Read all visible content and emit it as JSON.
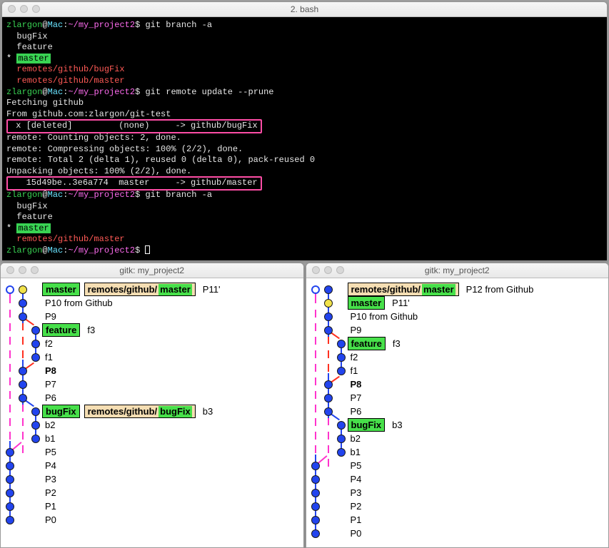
{
  "terminal": {
    "title": "2. bash",
    "prompt": {
      "user": "zlargon",
      "at": "@",
      "host": "Mac",
      "path": "~/my_project2",
      "sep": ":",
      "end": "$"
    },
    "lines": [
      {
        "t": "prompt",
        "cmd": "git branch -a"
      },
      {
        "t": "plain",
        "text": "  bugFix"
      },
      {
        "t": "plain",
        "text": "  feature"
      },
      {
        "t": "current",
        "text": "master"
      },
      {
        "t": "red",
        "text": "  remotes/github/bugFix"
      },
      {
        "t": "red",
        "text": "  remotes/github/master"
      },
      {
        "t": "prompt",
        "cmd": "git remote update --prune"
      },
      {
        "t": "plain",
        "text": "Fetching github"
      },
      {
        "t": "plain",
        "text": "From github.com:zlargon/git-test"
      },
      {
        "t": "boxed",
        "text": " x [deleted]         (none)     -> github/bugFix"
      },
      {
        "t": "plain",
        "text": "remote: Counting objects: 2, done."
      },
      {
        "t": "plain",
        "text": "remote: Compressing objects: 100% (2/2), done."
      },
      {
        "t": "plain",
        "text": "remote: Total 2 (delta 1), reused 0 (delta 0), pack-reused 0"
      },
      {
        "t": "plain",
        "text": "Unpacking objects: 100% (2/2), done."
      },
      {
        "t": "boxed",
        "text": "   15d49be..3e6a774  master     -> github/master"
      },
      {
        "t": "prompt",
        "cmd": "git branch -a"
      },
      {
        "t": "plain",
        "text": "  bugFix"
      },
      {
        "t": "plain",
        "text": "  feature"
      },
      {
        "t": "current",
        "text": "master"
      },
      {
        "t": "red",
        "text": "  remotes/github/master"
      },
      {
        "t": "prompt",
        "cmd": "",
        "cursor": true
      }
    ]
  },
  "gitk_left": {
    "title": "gitk: my_project2",
    "rows": [
      {
        "l0": "hollow",
        "l1": "node-head",
        "tags": [
          {
            "k": "local",
            "t": "master"
          },
          {
            "k": "remote",
            "p": "remotes/github/",
            "n": "master"
          }
        ],
        "msg": "P11'",
        "conn": {
          "l0": [
            "down",
            "pink"
          ],
          "l1": [
            "down",
            "blue"
          ]
        }
      },
      {
        "l0": "none",
        "l1": "node",
        "msg": "P10 from Github",
        "conn": {
          "l0": [
            "updown",
            "pink"
          ],
          "l1": [
            "updown",
            "blue"
          ]
        }
      },
      {
        "l0": "none",
        "l1": "node",
        "msg": "P9",
        "conn": {
          "l0": [
            "updown",
            "pink"
          ],
          "l1": [
            "updown",
            "blue"
          ],
          "spawn": "red"
        }
      },
      {
        "l0": "none",
        "l1": "none",
        "l2": "node",
        "tags": [
          {
            "k": "local",
            "t": "feature"
          }
        ],
        "msg": "f3",
        "conn": {
          "l0": [
            "updown",
            "pink"
          ],
          "l1": [
            "updown",
            "red"
          ],
          "l2": [
            "down",
            "blue"
          ]
        }
      },
      {
        "l0": "none",
        "l1": "none",
        "l2": "node",
        "msg": "f2",
        "conn": {
          "l0": [
            "updown",
            "pink"
          ],
          "l1": [
            "updown",
            "red"
          ],
          "l2": [
            "updown",
            "blue"
          ]
        }
      },
      {
        "l0": "none",
        "l1": "none",
        "l2": "node",
        "msg": "f1",
        "conn": {
          "l0": [
            "updown",
            "pink"
          ],
          "l1": [
            "updown",
            "red"
          ],
          "l2": [
            "up",
            "blue"
          ]
        }
      },
      {
        "l0": "none",
        "l1": "node",
        "msg": "P8",
        "bold": true,
        "conn": {
          "l0": [
            "updown",
            "pink"
          ],
          "l1": [
            "updown",
            "blue"
          ],
          "merge": "red"
        }
      },
      {
        "l0": "none",
        "l1": "node",
        "msg": "P7",
        "conn": {
          "l0": [
            "updown",
            "pink"
          ],
          "l1": [
            "updown",
            "blue"
          ]
        }
      },
      {
        "l0": "none",
        "l1": "node",
        "msg": "P6",
        "conn": {
          "l0": [
            "updown",
            "pink"
          ],
          "l1": [
            "updown",
            "blue"
          ],
          "spawn": "blue"
        }
      },
      {
        "l0": "none",
        "l1": "none",
        "l2": "node",
        "tags": [
          {
            "k": "local",
            "t": "bugFix"
          },
          {
            "k": "remote",
            "p": "remotes/github/",
            "n": "bugFix"
          }
        ],
        "msg": "b3",
        "conn": {
          "l0": [
            "updown",
            "pink"
          ],
          "l1": [
            "updown",
            "pink"
          ],
          "l2": [
            "down",
            "blue"
          ]
        }
      },
      {
        "l0": "none",
        "l1": "none",
        "l2": "node",
        "msg": "b2",
        "conn": {
          "l0": [
            "updown",
            "pink"
          ],
          "l1": [
            "updown",
            "pink"
          ],
          "l2": [
            "updown",
            "blue"
          ]
        }
      },
      {
        "l0": "none",
        "l1": "none",
        "l2": "node",
        "msg": "b1",
        "conn": {
          "l0": [
            "updown",
            "pink"
          ],
          "l1": [
            "updown",
            "pink"
          ],
          "l2": [
            "up",
            "blue"
          ]
        }
      },
      {
        "l0": "node",
        "msg": "P5",
        "conn": {
          "l0": [
            "updown",
            "blue"
          ],
          "mergeP": "pink"
        }
      },
      {
        "l0": "node",
        "msg": "P4",
        "conn": {
          "l0": [
            "updown",
            "blue"
          ]
        }
      },
      {
        "l0": "node",
        "msg": "P3",
        "conn": {
          "l0": [
            "updown",
            "blue"
          ]
        }
      },
      {
        "l0": "node",
        "msg": "P2",
        "conn": {
          "l0": [
            "updown",
            "blue"
          ]
        }
      },
      {
        "l0": "node",
        "msg": "P1",
        "conn": {
          "l0": [
            "updown",
            "blue"
          ]
        }
      },
      {
        "l0": "node",
        "msg": "P0",
        "conn": {
          "l0": [
            "up",
            "blue"
          ]
        }
      }
    ]
  },
  "gitk_right": {
    "title": "gitk: my_project2",
    "rows": [
      {
        "l0": "hollow",
        "l1": "node",
        "tags": [
          {
            "k": "remote",
            "p": "remotes/github/",
            "n": "master"
          }
        ],
        "msg": "P12 from Github",
        "conn": {
          "l0": [
            "down",
            "pink"
          ],
          "l1": [
            "down",
            "blue"
          ]
        }
      },
      {
        "l0": "none",
        "l1": "node-head",
        "tags": [
          {
            "k": "local",
            "t": "master"
          }
        ],
        "msg": "P11'",
        "conn": {
          "l0": [
            "updown",
            "pink"
          ],
          "l1": [
            "updown",
            "blue"
          ]
        }
      },
      {
        "l0": "none",
        "l1": "node",
        "msg": "P10 from Github",
        "conn": {
          "l0": [
            "updown",
            "pink"
          ],
          "l1": [
            "updown",
            "blue"
          ]
        }
      },
      {
        "l0": "none",
        "l1": "node",
        "msg": "P9",
        "conn": {
          "l0": [
            "updown",
            "pink"
          ],
          "l1": [
            "updown",
            "blue"
          ],
          "spawn": "red"
        }
      },
      {
        "l0": "none",
        "l1": "none",
        "l2": "node",
        "tags": [
          {
            "k": "local",
            "t": "feature"
          }
        ],
        "msg": "f3",
        "conn": {
          "l0": [
            "updown",
            "pink"
          ],
          "l1": [
            "updown",
            "red"
          ],
          "l2": [
            "down",
            "blue"
          ]
        }
      },
      {
        "l0": "none",
        "l1": "none",
        "l2": "node",
        "msg": "f2",
        "conn": {
          "l0": [
            "updown",
            "pink"
          ],
          "l1": [
            "updown",
            "red"
          ],
          "l2": [
            "updown",
            "blue"
          ]
        }
      },
      {
        "l0": "none",
        "l1": "none",
        "l2": "node",
        "msg": "f1",
        "conn": {
          "l0": [
            "updown",
            "pink"
          ],
          "l1": [
            "updown",
            "red"
          ],
          "l2": [
            "up",
            "blue"
          ]
        }
      },
      {
        "l0": "none",
        "l1": "node",
        "msg": "P8",
        "bold": true,
        "conn": {
          "l0": [
            "updown",
            "pink"
          ],
          "l1": [
            "updown",
            "blue"
          ],
          "merge": "red"
        }
      },
      {
        "l0": "none",
        "l1": "node",
        "msg": "P7",
        "conn": {
          "l0": [
            "updown",
            "pink"
          ],
          "l1": [
            "updown",
            "blue"
          ]
        }
      },
      {
        "l0": "none",
        "l1": "node",
        "msg": "P6",
        "conn": {
          "l0": [
            "updown",
            "pink"
          ],
          "l1": [
            "updown",
            "blue"
          ],
          "spawn": "blue"
        }
      },
      {
        "l0": "none",
        "l1": "none",
        "l2": "node",
        "tags": [
          {
            "k": "local",
            "t": "bugFix"
          }
        ],
        "msg": "b3",
        "conn": {
          "l0": [
            "updown",
            "pink"
          ],
          "l1": [
            "updown",
            "pink"
          ],
          "l2": [
            "down",
            "blue"
          ]
        }
      },
      {
        "l0": "none",
        "l1": "none",
        "l2": "node",
        "msg": "b2",
        "conn": {
          "l0": [
            "updown",
            "pink"
          ],
          "l1": [
            "updown",
            "pink"
          ],
          "l2": [
            "updown",
            "blue"
          ]
        }
      },
      {
        "l0": "none",
        "l1": "none",
        "l2": "node",
        "msg": "b1",
        "conn": {
          "l0": [
            "updown",
            "pink"
          ],
          "l1": [
            "updown",
            "pink"
          ],
          "l2": [
            "up",
            "blue"
          ]
        }
      },
      {
        "l0": "node",
        "msg": "P5",
        "conn": {
          "l0": [
            "updown",
            "blue"
          ],
          "mergeP": "pink"
        }
      },
      {
        "l0": "node",
        "msg": "P4",
        "conn": {
          "l0": [
            "updown",
            "blue"
          ]
        }
      },
      {
        "l0": "node",
        "msg": "P3",
        "conn": {
          "l0": [
            "updown",
            "blue"
          ]
        }
      },
      {
        "l0": "node",
        "msg": "P2",
        "conn": {
          "l0": [
            "updown",
            "blue"
          ]
        }
      },
      {
        "l0": "node",
        "msg": "P1",
        "conn": {
          "l0": [
            "updown",
            "blue"
          ]
        }
      },
      {
        "l0": "node",
        "msg": "P0",
        "conn": {
          "l0": [
            "up",
            "blue"
          ]
        }
      }
    ]
  }
}
